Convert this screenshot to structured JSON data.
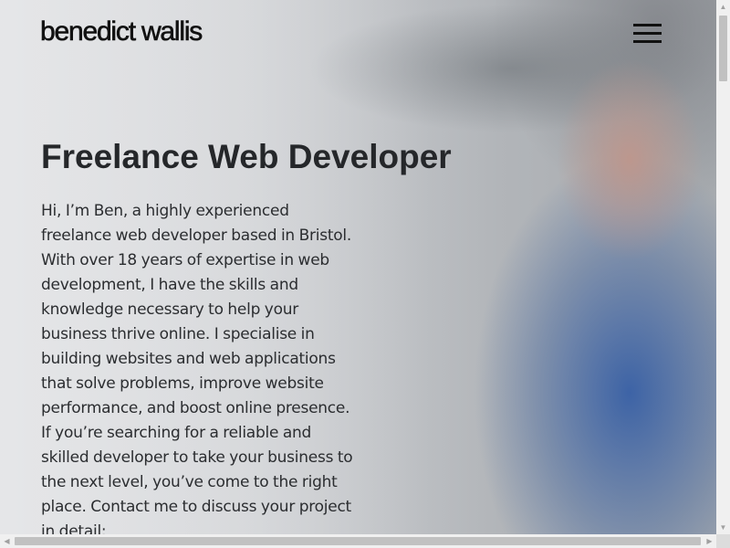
{
  "header": {
    "logo_text": "benedict wallis",
    "menu_icon": "hamburger-menu-icon"
  },
  "hero": {
    "title": "Freelance Web Developer",
    "intro": "Hi, I’m Ben, a highly experienced freelance web developer based in Bristol. With over 18 years of expertise in web development, I have the skills and knowledge necessary to help your business thrive online. I specialise in building websites and web applications that solve problems, improve website performance, and boost online presence. If you’re searching for a reliable and skilled developer to take your business to the next level, you’ve come to the right place. Contact me to discuss your project in detail:"
  },
  "scrollbars": {
    "vertical_position": 0,
    "horizontal_position": 0
  },
  "colors": {
    "text_dark": "#25272a",
    "accent_blue": "#375fa5"
  }
}
